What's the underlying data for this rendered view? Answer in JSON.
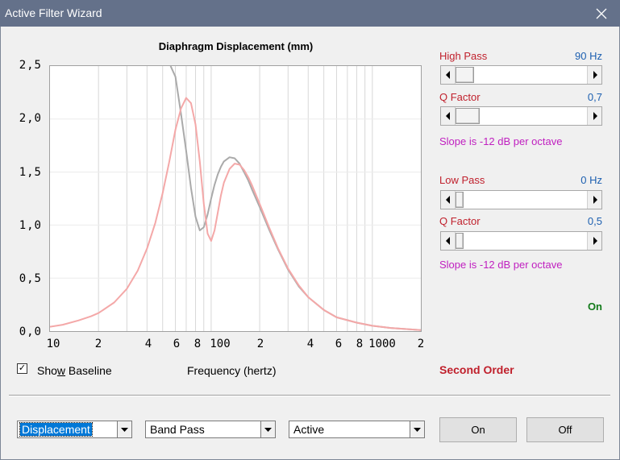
{
  "window": {
    "title": "Active Filter Wizard",
    "close_icon": "close-icon"
  },
  "chart": {
    "title": "Diaphragm Displacement (mm)",
    "x_axis_label_text": "Frequency (hertz)",
    "y_ticks": [
      "2,5",
      "2,0",
      "1,5",
      "1,0",
      "0,5",
      "0,0"
    ],
    "x_ticks": [
      "10",
      "2",
      "4",
      "6",
      "8",
      "100",
      "2",
      "4",
      "6",
      "8",
      "1000",
      "2"
    ]
  },
  "chart_data": {
    "type": "line",
    "title": "Diaphragm Displacement (mm)",
    "xlabel": "Frequency (hertz)",
    "ylabel": "",
    "x_scale": "log",
    "xlim": [
      10,
      2000
    ],
    "ylim": [
      0,
      2.5
    ],
    "grid": true,
    "series": [
      {
        "color": "#aaaaaa",
        "x": [
          56,
          60,
          65,
          70,
          75,
          80,
          85,
          90,
          95,
          100,
          105,
          110,
          115,
          120,
          130,
          140,
          150,
          160,
          170,
          180,
          200,
          230,
          260,
          300,
          350,
          400,
          500,
          600,
          800,
          1000,
          1300,
          1600,
          2000
        ],
        "y": [
          2.5,
          2.4,
          2.05,
          1.7,
          1.35,
          1.08,
          0.95,
          0.98,
          1.1,
          1.25,
          1.38,
          1.48,
          1.55,
          1.6,
          1.64,
          1.63,
          1.58,
          1.5,
          1.42,
          1.33,
          1.17,
          0.95,
          0.77,
          0.58,
          0.42,
          0.32,
          0.2,
          0.13,
          0.08,
          0.05,
          0.03,
          0.02,
          0.01
        ]
      },
      {
        "color": "#f4a8a8",
        "x": [
          10,
          12,
          15,
          18,
          20,
          25,
          30,
          35,
          40,
          45,
          50,
          55,
          60,
          65,
          70,
          75,
          80,
          85,
          90,
          95,
          100,
          105,
          110,
          115,
          120,
          130,
          140,
          150,
          160,
          170,
          180,
          200,
          230,
          260,
          300,
          350,
          400,
          500,
          600,
          800,
          1000,
          1300,
          1600,
          2000
        ],
        "y": [
          0.04,
          0.06,
          0.1,
          0.14,
          0.17,
          0.27,
          0.4,
          0.57,
          0.78,
          1.02,
          1.3,
          1.6,
          1.9,
          2.1,
          2.2,
          2.15,
          1.95,
          1.6,
          1.2,
          0.92,
          0.85,
          0.95,
          1.12,
          1.28,
          1.4,
          1.53,
          1.58,
          1.57,
          1.52,
          1.45,
          1.37,
          1.2,
          0.97,
          0.78,
          0.59,
          0.43,
          0.32,
          0.2,
          0.13,
          0.08,
          0.05,
          0.03,
          0.02,
          0.01
        ]
      }
    ]
  },
  "controls": {
    "high_pass": {
      "label": "High Pass",
      "value": "90 Hz",
      "level": 0.1
    },
    "high_q": {
      "label": "Q Factor",
      "value": "0,7",
      "level": 0.12
    },
    "high_slope": "Slope is -12 dB per octave",
    "low_pass": {
      "label": "Low Pass",
      "value": "0 Hz",
      "level": 0.0
    },
    "low_q": {
      "label": "Q Factor",
      "value": "0,5",
      "level": 0.0
    },
    "low_slope": "Slope is -12 dB per octave",
    "status": "On",
    "order": "Second Order"
  },
  "show_baseline": {
    "label_pre": "Sho",
    "label_underline": "w",
    "label_post": " Baseline",
    "checked": true,
    "mark": "✓"
  },
  "bottom": {
    "mode_combo": "Displacement",
    "type_combo": "Band Pass",
    "active_combo": "Active",
    "on_button": "On",
    "off_button": "Off"
  },
  "colors": {
    "titlebar": "#64718a",
    "red_label": "#c0202c",
    "blue_value": "#1c5fb0",
    "magenta": "#c020c0",
    "green": "#127a1a",
    "curve_gray": "#aaaaaa",
    "curve_pink": "#f4a8a8"
  }
}
